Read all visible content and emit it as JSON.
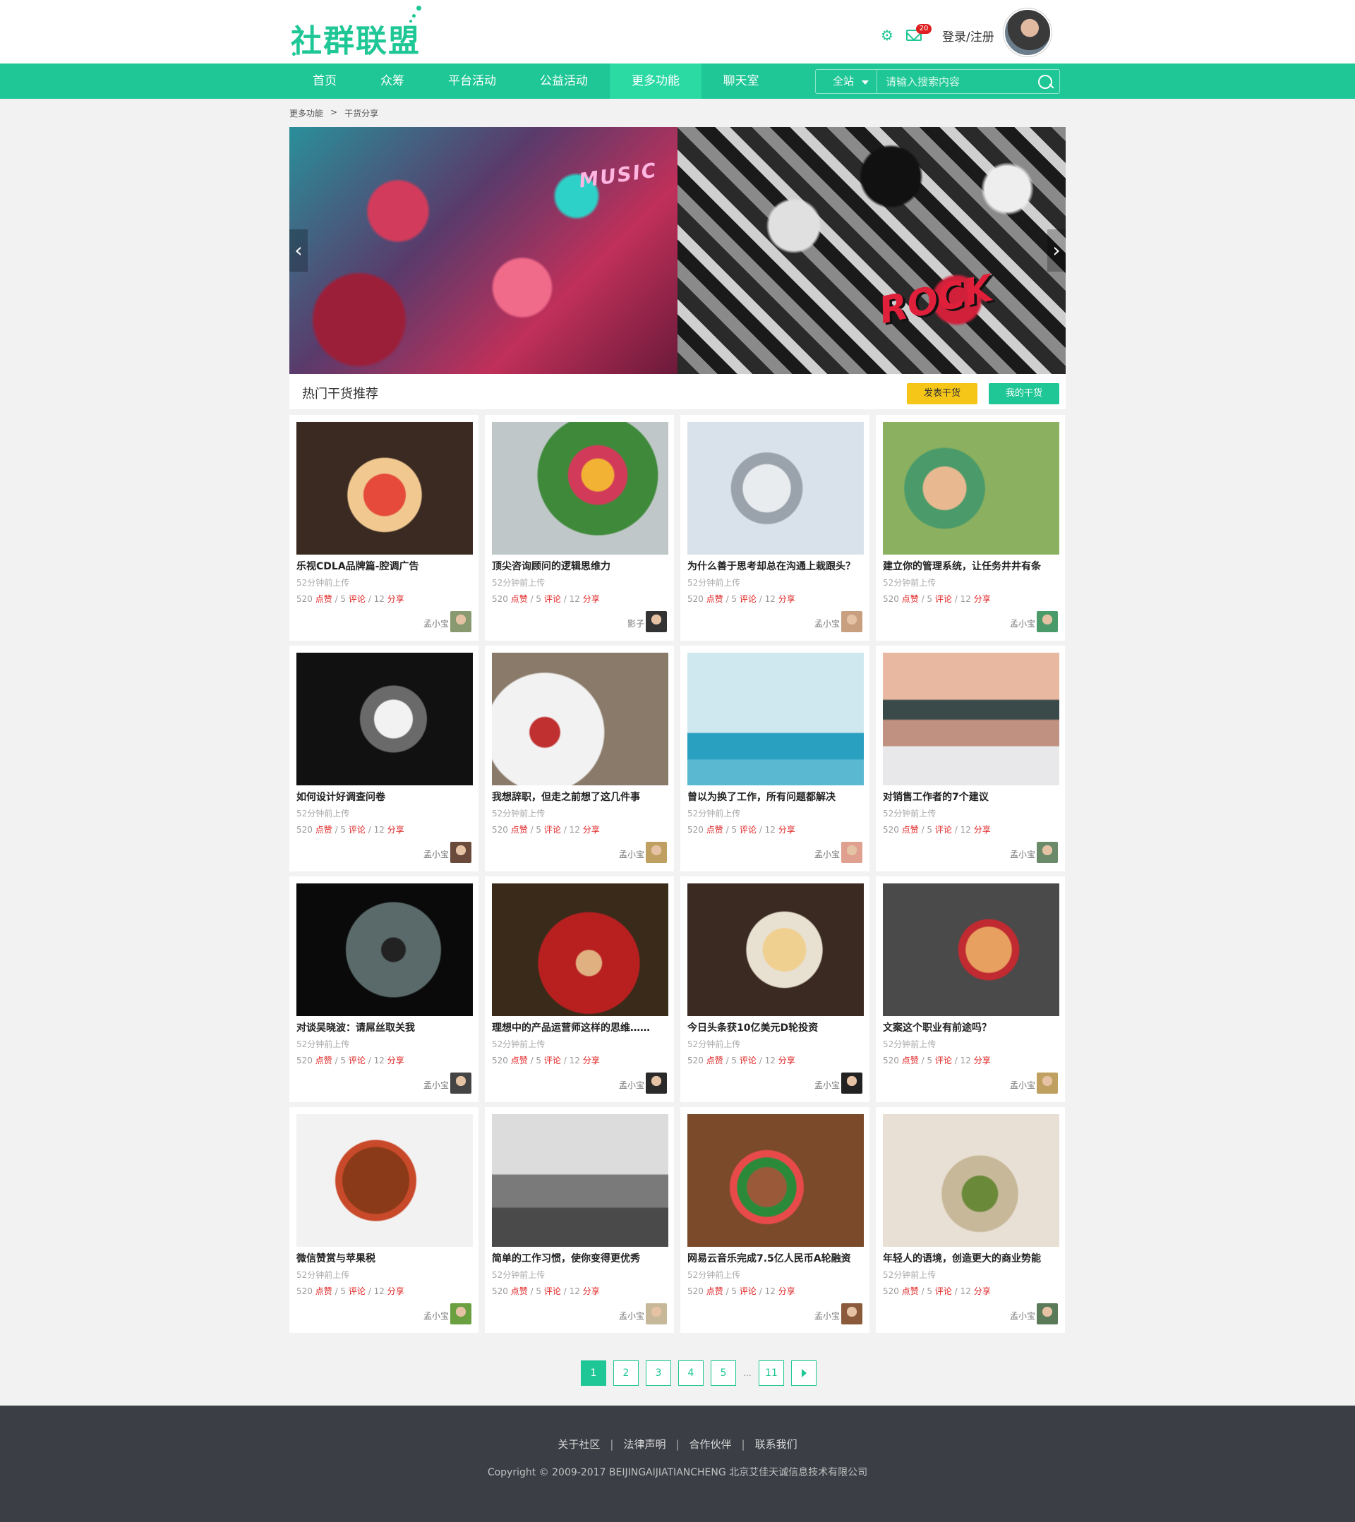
{
  "brand": {
    "logo_text": "社群联盟",
    "accent": "#1ec795"
  },
  "header": {
    "mail_badge": "20",
    "login_label": "登录/注册",
    "settings_icon": "gear-icon",
    "mail_icon": "mail-icon"
  },
  "nav": {
    "items": [
      {
        "label": "首页"
      },
      {
        "label": "众筹"
      },
      {
        "label": "平台活动"
      },
      {
        "label": "公益活动"
      },
      {
        "label": "更多功能",
        "active": true
      },
      {
        "label": "聊天室"
      }
    ],
    "search": {
      "scope": "全站",
      "placeholder": "请输入搜索内容"
    }
  },
  "breadcrumb": {
    "parent": "更多功能",
    "separator": ">",
    "current": "干货分享"
  },
  "banner": {
    "left_text": "MUSIC",
    "right_text": "ROCK"
  },
  "section": {
    "title": "热门干货推荐",
    "publish_label": "发表干货",
    "mine_label": "我的干货"
  },
  "cards": [
    {
      "title": "乐视CDLA品牌篇-腔调广告",
      "time": "52分钟前上传",
      "likes": "520",
      "likes_label": "点赞",
      "comments": "5",
      "comments_label": "评论",
      "shares": "12",
      "shares_label": "分享",
      "author": "孟小宝"
    },
    {
      "title": "顶尖咨询顾问的逻辑思维力",
      "time": "52分钟前上传",
      "likes": "520",
      "likes_label": "点赞",
      "comments": "5",
      "comments_label": "评论",
      "shares": "12",
      "shares_label": "分享",
      "author": "影子"
    },
    {
      "title": "为什么善于思考却总在沟通上栽跟头？",
      "time": "52分钟前上传",
      "likes": "520",
      "likes_label": "点赞",
      "comments": "5",
      "comments_label": "评论",
      "shares": "12",
      "shares_label": "分享",
      "author": "孟小宝"
    },
    {
      "title": "建立你的管理系统，让任务井井有条",
      "time": "52分钟前上传",
      "likes": "520",
      "likes_label": "点赞",
      "comments": "5",
      "comments_label": "评论",
      "shares": "12",
      "shares_label": "分享",
      "author": "孟小宝"
    },
    {
      "title": "如何设计好调查问卷",
      "time": "52分钟前上传",
      "likes": "520",
      "likes_label": "点赞",
      "comments": "5",
      "comments_label": "评论",
      "shares": "12",
      "shares_label": "分享",
      "author": "孟小宝"
    },
    {
      "title": "我想辞职，但走之前想了这几件事",
      "time": "52分钟前上传",
      "likes": "520",
      "likes_label": "点赞",
      "comments": "5",
      "comments_label": "评论",
      "shares": "12",
      "shares_label": "分享",
      "author": "孟小宝"
    },
    {
      "title": "曾以为换了工作，所有问题都解决",
      "time": "52分钟前上传",
      "likes": "520",
      "likes_label": "点赞",
      "comments": "5",
      "comments_label": "评论",
      "shares": "12",
      "shares_label": "分享",
      "author": "孟小宝"
    },
    {
      "title": "对销售工作者的7个建议",
      "time": "52分钟前上传",
      "likes": "520",
      "likes_label": "点赞",
      "comments": "5",
      "comments_label": "评论",
      "shares": "12",
      "shares_label": "分享",
      "author": "孟小宝"
    },
    {
      "title": "对谈吴晓波：请屌丝取关我",
      "time": "52分钟前上传",
      "likes": "520",
      "likes_label": "点赞",
      "comments": "5",
      "comments_label": "评论",
      "shares": "12",
      "shares_label": "分享",
      "author": "孟小宝"
    },
    {
      "title": "理想中的产品运营师这样的思维……",
      "time": "52分钟前上传",
      "likes": "520",
      "likes_label": "点赞",
      "comments": "5",
      "comments_label": "评论",
      "shares": "12",
      "shares_label": "分享",
      "author": "孟小宝"
    },
    {
      "title": "今日头条获10亿美元D轮投资",
      "time": "52分钟前上传",
      "likes": "520",
      "likes_label": "点赞",
      "comments": "5",
      "comments_label": "评论",
      "shares": "12",
      "shares_label": "分享",
      "author": "孟小宝"
    },
    {
      "title": "文案这个职业有前途吗？",
      "time": "52分钟前上传",
      "likes": "520",
      "likes_label": "点赞",
      "comments": "5",
      "comments_label": "评论",
      "shares": "12",
      "shares_label": "分享",
      "author": "孟小宝"
    },
    {
      "title": "微信赞赏与苹果税",
      "time": "52分钟前上传",
      "likes": "520",
      "likes_label": "点赞",
      "comments": "5",
      "comments_label": "评论",
      "shares": "12",
      "shares_label": "分享",
      "author": "孟小宝"
    },
    {
      "title": "简单的工作习惯，使你变得更优秀",
      "time": "52分钟前上传",
      "likes": "520",
      "likes_label": "点赞",
      "comments": "5",
      "comments_label": "评论",
      "shares": "12",
      "shares_label": "分享",
      "author": "孟小宝"
    },
    {
      "title": "网易云音乐完成7.5亿人民币A轮融资",
      "time": "52分钟前上传",
      "likes": "520",
      "likes_label": "点赞",
      "comments": "5",
      "comments_label": "评论",
      "shares": "12",
      "shares_label": "分享",
      "author": "孟小宝"
    },
    {
      "title": "年轻人的语境，创造更大的商业势能",
      "time": "52分钟前上传",
      "likes": "520",
      "likes_label": "点赞",
      "comments": "5",
      "comments_label": "评论",
      "shares": "12",
      "shares_label": "分享",
      "author": "孟小宝"
    }
  ],
  "pagination": {
    "pages": [
      "1",
      "2",
      "3",
      "4",
      "5"
    ],
    "ellipsis": "...",
    "last": "11",
    "current": "1",
    "next_icon": "triangle-right-icon"
  },
  "footer": {
    "links": [
      "关于社区",
      "法律声明",
      "合作伙伴",
      "联系我们"
    ],
    "separator": "|",
    "copyright": "Copyright © 2009-2017 BEIJINGAIJIATIANCHENG 北京艾佳天诚信息技术有限公司"
  }
}
